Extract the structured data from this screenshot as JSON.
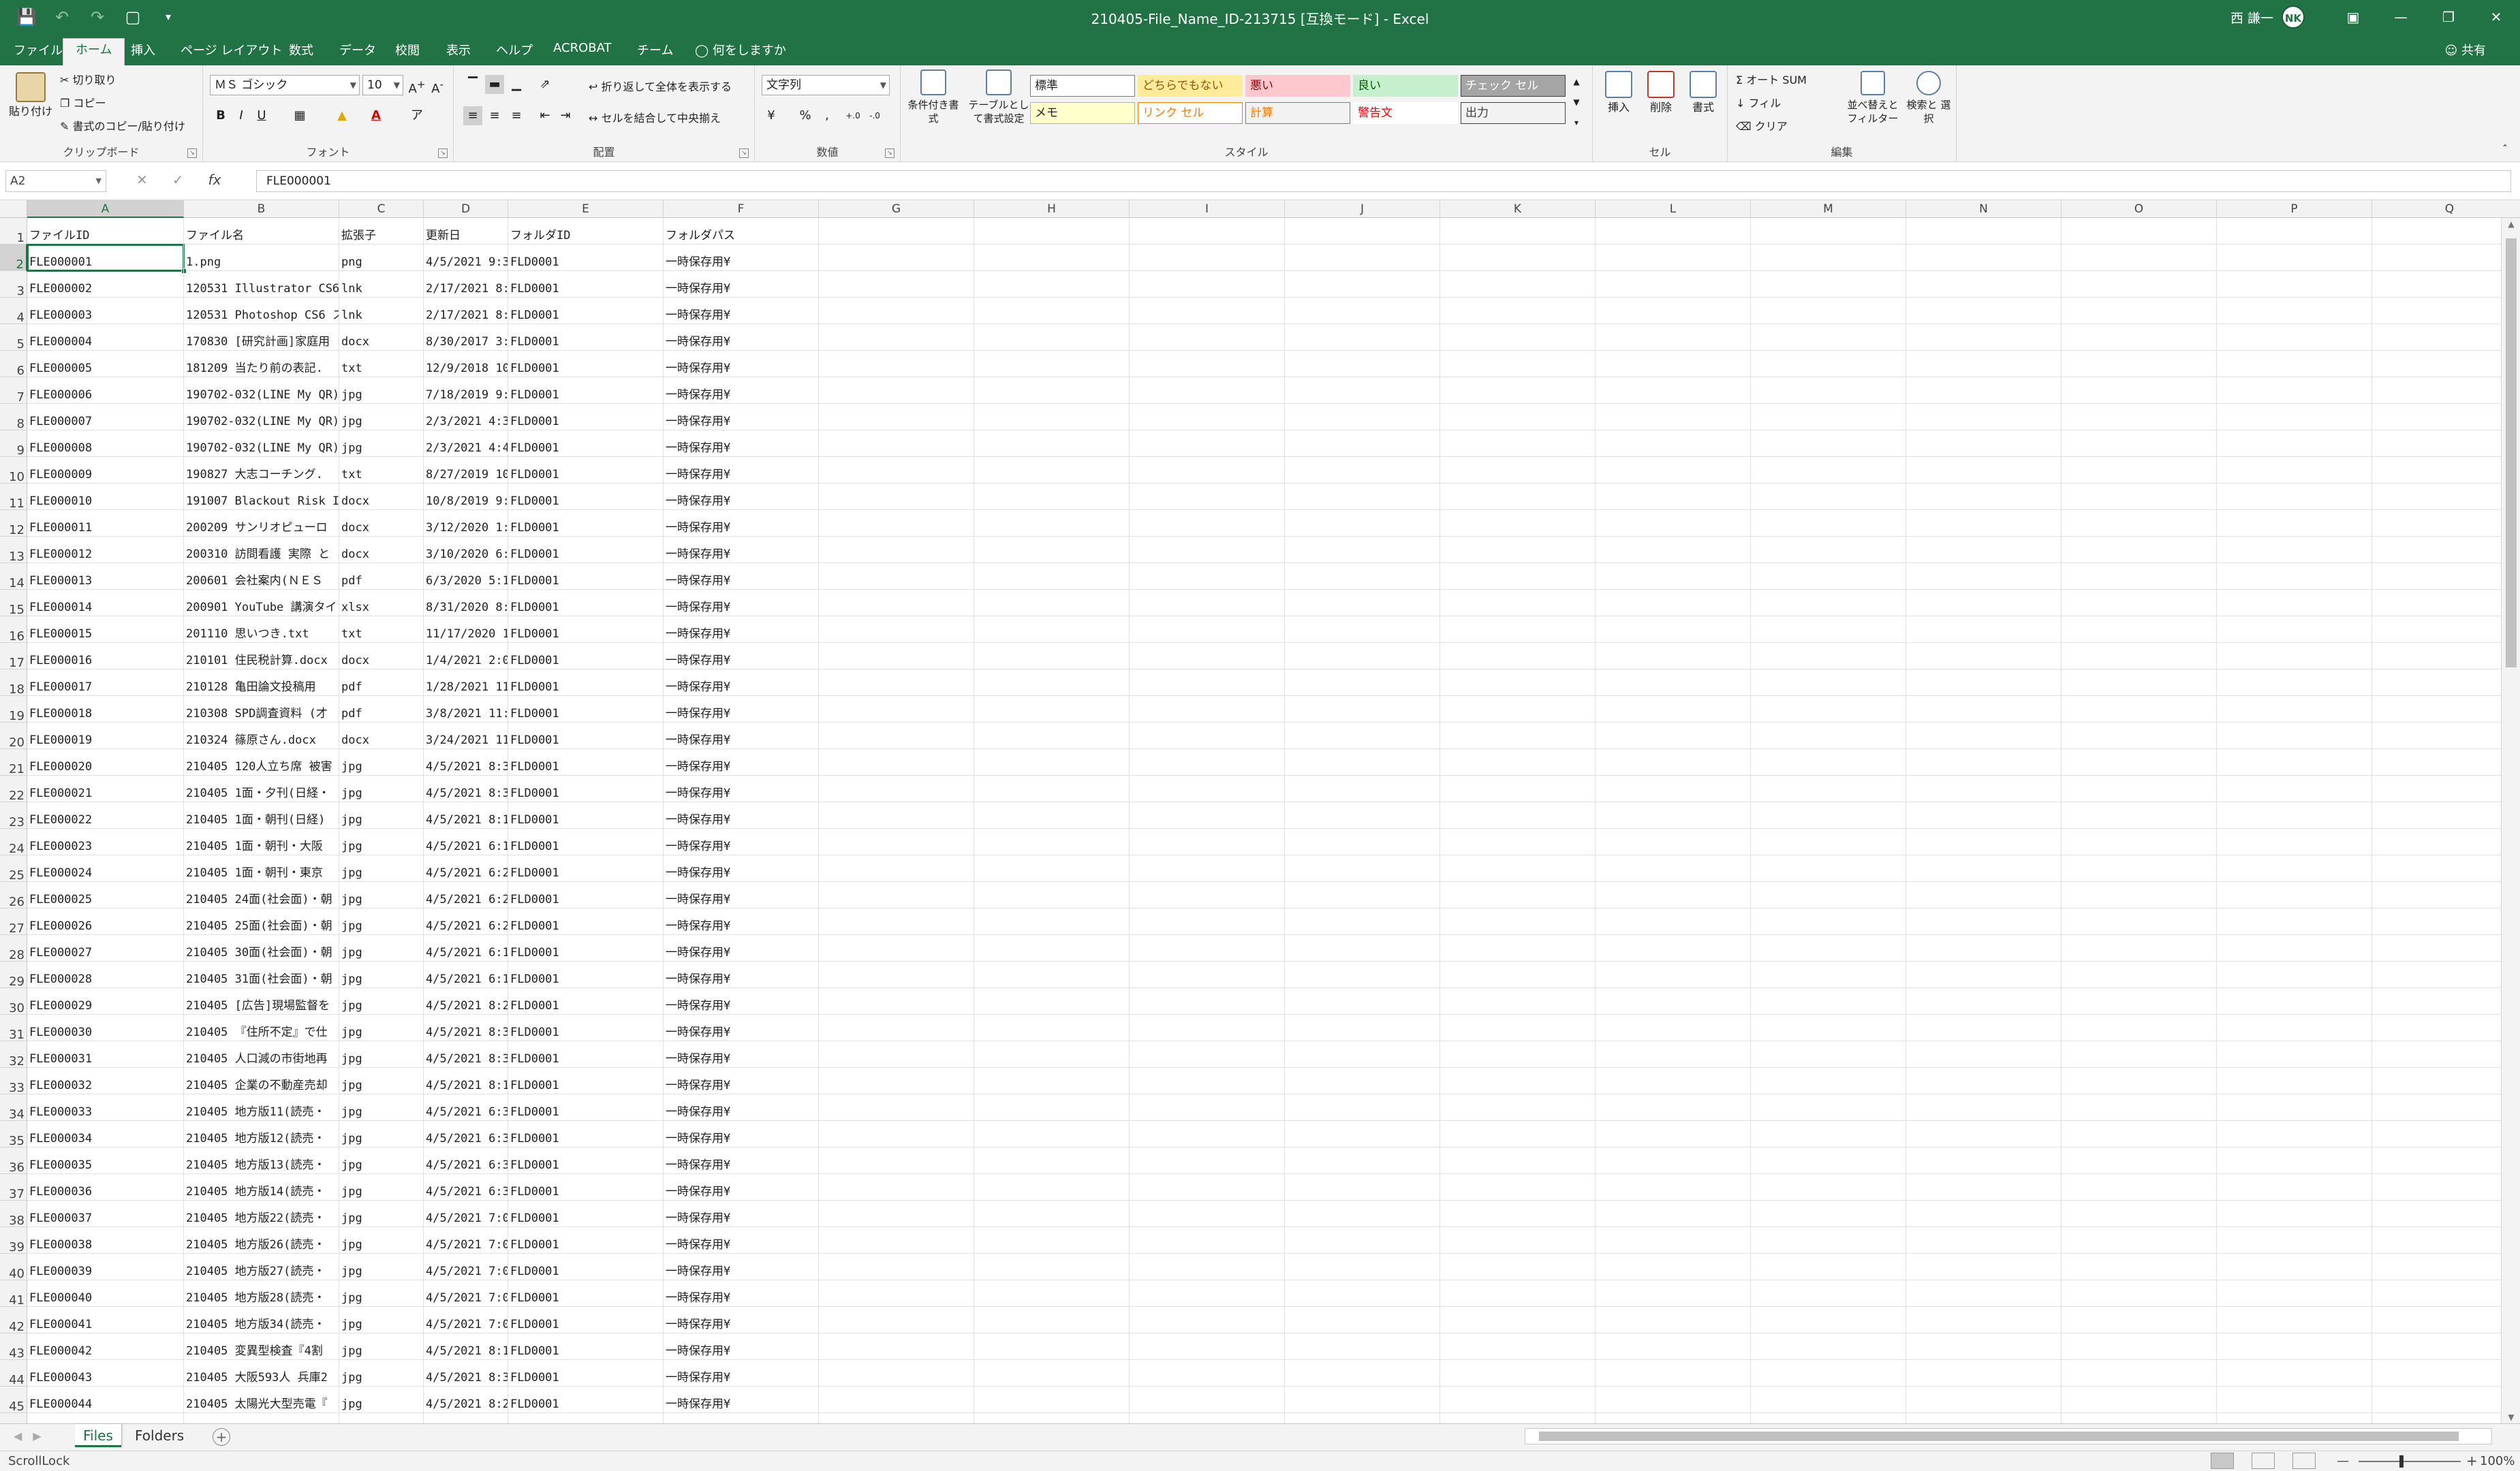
{
  "window": {
    "title": "210405-File_Name_ID-213715 [互換モード] - Excel",
    "user": "西 謙一",
    "avatar": "NK",
    "controls": [
      "display-options",
      "minimize",
      "restore",
      "close"
    ]
  },
  "quick_access": [
    "save-icon",
    "undo-icon",
    "redo-icon",
    "print-preview-icon",
    "customize-icon"
  ],
  "ribbon_tabs": [
    "ファイル",
    "ホーム",
    "挿入",
    "ページ レイアウト",
    "数式",
    "データ",
    "校閲",
    "表示",
    "ヘルプ",
    "ACROBAT",
    "チーム"
  ],
  "active_tab": "ホーム",
  "tell_me": "何をしますか",
  "share": "共有",
  "ribbon": {
    "clipboard": {
      "label": "クリップボード",
      "paste": "貼り付け",
      "cut": "切り取り",
      "copy": "コピー",
      "format_painter": "書式のコピー/貼り付け"
    },
    "font": {
      "label": "フォント",
      "font_name": "ＭＳ ゴシック",
      "font_size": "10",
      "bold": "B",
      "italic": "I",
      "underline": "U"
    },
    "alignment": {
      "label": "配置",
      "wrap": "折り返して全体を表示する",
      "merge": "セルを結合して中央揃え"
    },
    "number": {
      "label": "数値",
      "format": "文字列",
      "percent": "%",
      "comma": ","
    },
    "styles": {
      "label": "スタイル",
      "conditional": "条件付き書式",
      "table": "テーブルとして書式設定",
      "cells": [
        {
          "text": "標準",
          "bg": "#ffffff",
          "fg": "#222222",
          "border": "#7a7a7a"
        },
        {
          "text": "どちらでもない",
          "bg": "#ffeb9c",
          "fg": "#9c5700",
          "border": "#ffeb9c"
        },
        {
          "text": "悪い",
          "bg": "#ffc7ce",
          "fg": "#9c0006",
          "border": "#ffc7ce"
        },
        {
          "text": "良い",
          "bg": "#c6efce",
          "fg": "#006100",
          "border": "#c6efce"
        },
        {
          "text": "チェック セル",
          "bg": "#a5a5a5",
          "fg": "#ffffff",
          "border": "#3f3f3f"
        },
        {
          "text": "メモ",
          "bg": "#ffffcc",
          "fg": "#222222",
          "border": "#b2b2b2"
        },
        {
          "text": "リンク セル",
          "bg": "#ffffff",
          "fg": "#fa7d00",
          "border": "#ff8001"
        },
        {
          "text": "計算",
          "bg": "#f2f2f2",
          "fg": "#fa7d00",
          "border": "#7f7f7f"
        },
        {
          "text": "警告文",
          "bg": "#ffffff",
          "fg": "#ff0000",
          "border": "#ffffff"
        },
        {
          "text": "出力",
          "bg": "#f2f2f2",
          "fg": "#3f3f3f",
          "border": "#3f3f3f"
        }
      ]
    },
    "cells": {
      "label": "セル",
      "insert": "挿入",
      "delete": "削除",
      "format": "書式"
    },
    "editing": {
      "label": "編集",
      "autosum": "オート SUM",
      "fill": "フィル",
      "clear": "クリア",
      "sort": "並べ替えと フィルター",
      "find": "検索と 選択"
    }
  },
  "formula_bar": {
    "name_box": "A2",
    "fx": "fx",
    "value": "FLE000001"
  },
  "grid": {
    "columns": [
      "A",
      "B",
      "C",
      "D",
      "E",
      "F",
      "G",
      "H",
      "I",
      "J",
      "K",
      "L",
      "M",
      "N",
      "O",
      "P",
      "Q"
    ],
    "selected_column": "A",
    "selected_row": 2,
    "rows": [
      [
        "ファイルID",
        "ファイル名",
        "拡張子",
        "更新日",
        "フォルダID",
        "フォルダパス"
      ],
      [
        "FLE000001",
        "1.png",
        "png",
        "4/5/2021 9:3",
        "FLD0001",
        "一時保存用¥"
      ],
      [
        "FLE000002",
        "120531 Illustrator CS6",
        "lnk",
        "2/17/2021 8:",
        "FLD0001",
        "一時保存用¥"
      ],
      [
        "FLE000003",
        "120531 Photoshop CS6 ス",
        "lnk",
        "2/17/2021 8:",
        "FLD0001",
        "一時保存用¥"
      ],
      [
        "FLE000004",
        "170830 [研究計画]家庭用",
        "docx",
        "8/30/2017 3:",
        "FLD0001",
        "一時保存用¥"
      ],
      [
        "FLE000005",
        "181209 当たり前の表記.",
        "txt",
        "12/9/2018 10",
        "FLD0001",
        "一時保存用¥"
      ],
      [
        "FLE000006",
        "190702-032(LINE My QR)",
        "jpg",
        "7/18/2019 9:",
        "FLD0001",
        "一時保存用¥"
      ],
      [
        "FLE000007",
        "190702-032(LINE My QR)",
        "jpg",
        "2/3/2021 4:3",
        "FLD0001",
        "一時保存用¥"
      ],
      [
        "FLE000008",
        "190702-032(LINE My QR)",
        "jpg",
        "2/3/2021 4:4",
        "FLD0001",
        "一時保存用¥"
      ],
      [
        "FLE000009",
        "190827 大志コーチング.",
        "txt",
        "8/27/2019 10",
        "FLD0001",
        "一時保存用¥"
      ],
      [
        "FLE000010",
        "191007 Blackout Risk Ir",
        "docx",
        "10/8/2019 9:",
        "FLD0001",
        "一時保存用¥"
      ],
      [
        "FLE000011",
        "200209 サンリオピューロ",
        "docx",
        "3/12/2020 1:",
        "FLD0001",
        "一時保存用¥"
      ],
      [
        "FLE000012",
        "200310 訪問看護 実際 と",
        "docx",
        "3/10/2020 6:",
        "FLD0001",
        "一時保存用¥"
      ],
      [
        "FLE000013",
        "200601 会社案内(ＮＥＳ",
        "pdf",
        "6/3/2020 5:1",
        "FLD0001",
        "一時保存用¥"
      ],
      [
        "FLE000014",
        "200901 YouTube 講演タイ",
        "xlsx",
        "8/31/2020 8:",
        "FLD0001",
        "一時保存用¥"
      ],
      [
        "FLE000015",
        "201110 思いつき.txt",
        "txt",
        "11/17/2020 1",
        "FLD0001",
        "一時保存用¥"
      ],
      [
        "FLE000016",
        "210101 住民税計算.docx",
        "docx",
        "1/4/2021 2:0",
        "FLD0001",
        "一時保存用¥"
      ],
      [
        "FLE000017",
        "210128 亀田論文投稿用",
        "pdf",
        "1/28/2021 11",
        "FLD0001",
        "一時保存用¥"
      ],
      [
        "FLE000018",
        "210308 SPD調査資料 (才",
        "pdf",
        "3/8/2021 11:",
        "FLD0001",
        "一時保存用¥"
      ],
      [
        "FLE000019",
        "210324 篠原さん.docx",
        "docx",
        "3/24/2021 11",
        "FLD0001",
        "一時保存用¥"
      ],
      [
        "FLE000020",
        "210405 120人立ち席 被害",
        "jpg",
        "4/5/2021 8:3",
        "FLD0001",
        "一時保存用¥"
      ],
      [
        "FLE000021",
        "210405 1面・夕刊(日経・",
        "jpg",
        "4/5/2021 8:3",
        "FLD0001",
        "一時保存用¥"
      ],
      [
        "FLE000022",
        "210405 1面・朝刊(日経)",
        "jpg",
        "4/5/2021 8:1",
        "FLD0001",
        "一時保存用¥"
      ],
      [
        "FLE000023",
        "210405 1面・朝刊・大阪",
        "jpg",
        "4/5/2021 6:1",
        "FLD0001",
        "一時保存用¥"
      ],
      [
        "FLE000024",
        "210405 1面・朝刊・東京",
        "jpg",
        "4/5/2021 6:2",
        "FLD0001",
        "一時保存用¥"
      ],
      [
        "FLE000025",
        "210405 24面(社会面)・朝",
        "jpg",
        "4/5/2021 6:2",
        "FLD0001",
        "一時保存用¥"
      ],
      [
        "FLE000026",
        "210405 25面(社会面)・朝",
        "jpg",
        "4/5/2021 6:2",
        "FLD0001",
        "一時保存用¥"
      ],
      [
        "FLE000027",
        "210405 30面(社会面)・朝",
        "jpg",
        "4/5/2021 6:1",
        "FLD0001",
        "一時保存用¥"
      ],
      [
        "FLE000028",
        "210405 31面(社会面)・朝",
        "jpg",
        "4/5/2021 6:1",
        "FLD0001",
        "一時保存用¥"
      ],
      [
        "FLE000029",
        "210405 [広告]現場監督を",
        "jpg",
        "4/5/2021 8:2",
        "FLD0001",
        "一時保存用¥"
      ],
      [
        "FLE000030",
        "210405 『住所不定』で仕",
        "jpg",
        "4/5/2021 8:3",
        "FLD0001",
        "一時保存用¥"
      ],
      [
        "FLE000031",
        "210405 人口減の市街地再",
        "jpg",
        "4/5/2021 8:3",
        "FLD0001",
        "一時保存用¥"
      ],
      [
        "FLE000032",
        "210405 企業の不動産売却",
        "jpg",
        "4/5/2021 8:1",
        "FLD0001",
        "一時保存用¥"
      ],
      [
        "FLE000033",
        "210405 地方版11(読売・",
        "jpg",
        "4/5/2021 6:3",
        "FLD0001",
        "一時保存用¥"
      ],
      [
        "FLE000034",
        "210405 地方版12(読売・",
        "jpg",
        "4/5/2021 6:3",
        "FLD0001",
        "一時保存用¥"
      ],
      [
        "FLE000035",
        "210405 地方版13(読売・",
        "jpg",
        "4/5/2021 6:3",
        "FLD0001",
        "一時保存用¥"
      ],
      [
        "FLE000036",
        "210405 地方版14(読売・",
        "jpg",
        "4/5/2021 6:3",
        "FLD0001",
        "一時保存用¥"
      ],
      [
        "FLE000037",
        "210405 地方版22(読売・",
        "jpg",
        "4/5/2021 7:0",
        "FLD0001",
        "一時保存用¥"
      ],
      [
        "FLE000038",
        "210405 地方版26(読売・",
        "jpg",
        "4/5/2021 7:0",
        "FLD0001",
        "一時保存用¥"
      ],
      [
        "FLE000039",
        "210405 地方版27(読売・",
        "jpg",
        "4/5/2021 7:0",
        "FLD0001",
        "一時保存用¥"
      ],
      [
        "FLE000040",
        "210405 地方版28(読売・",
        "jpg",
        "4/5/2021 7:0",
        "FLD0001",
        "一時保存用¥"
      ],
      [
        "FLE000041",
        "210405 地方版34(読売・",
        "jpg",
        "4/5/2021 7:0",
        "FLD0001",
        "一時保存用¥"
      ],
      [
        "FLE000042",
        "210405 変異型検査『4割",
        "jpg",
        "4/5/2021 8:1",
        "FLD0001",
        "一時保存用¥"
      ],
      [
        "FLE000043",
        "210405 大阪593人 兵庫2",
        "jpg",
        "4/5/2021 8:3",
        "FLD0001",
        "一時保存用¥"
      ],
      [
        "FLE000044",
        "210405 太陽光大型売電『",
        "jpg",
        "4/5/2021 8:2",
        "FLD0001",
        "一時保存用¥"
      ]
    ]
  },
  "sheets": [
    "Files",
    "Folders"
  ],
  "active_sheet": "Files",
  "status": {
    "mode": "ScrollLock",
    "zoom": "100%"
  }
}
